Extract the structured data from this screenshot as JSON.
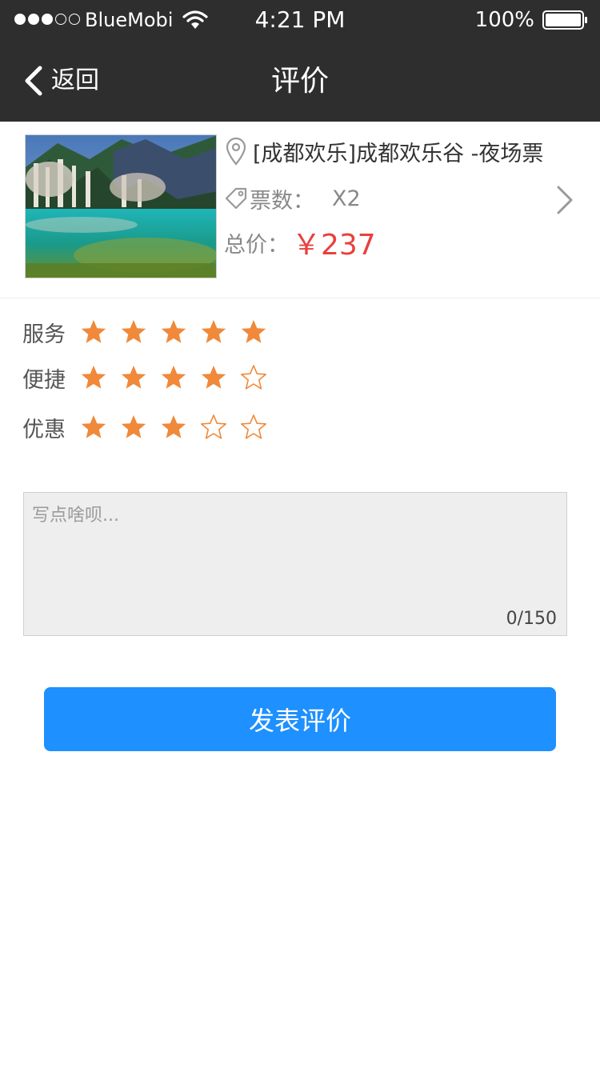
{
  "status_bar": {
    "carrier": "BlueMobi",
    "time": "4:21 PM",
    "battery": "100%"
  },
  "nav": {
    "back_label": "返回",
    "title": "评价"
  },
  "order": {
    "title": "[成都欢乐]成都欢乐谷 -夜场票",
    "tickets_label": "票数：",
    "tickets_value": "X2",
    "total_label": "总价：",
    "total_value": "￥237"
  },
  "ratings": [
    {
      "label": "服务",
      "stars": 5,
      "max": 5
    },
    {
      "label": "便捷",
      "stars": 4,
      "max": 5
    },
    {
      "label": "优惠",
      "stars": 3,
      "max": 5
    }
  ],
  "comment": {
    "placeholder": "写点啥呗...",
    "value": "",
    "count": "0/150"
  },
  "submit_label": "发表评价",
  "colors": {
    "bar": "#2e2e2e",
    "star": "#f0893a",
    "price": "#e8413d",
    "button": "#1e90ff"
  },
  "icons": [
    "wifi-icon",
    "battery-icon",
    "back-icon",
    "pin-icon",
    "tag-icon",
    "chevron-right-icon",
    "star-icon"
  ]
}
